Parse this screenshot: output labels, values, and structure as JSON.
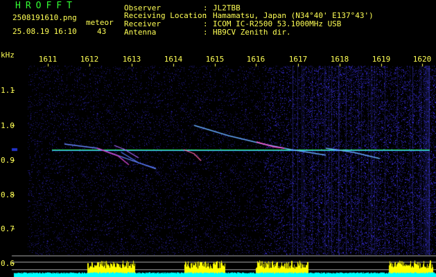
{
  "header": {
    "app_title": "HROFFT",
    "filename": "2508191610.png",
    "datetime": "25.08.19 16:10",
    "meteor_label": "meteor",
    "meteor_count": "43",
    "info_labels": [
      "Observer",
      "Receiving Location",
      "Receiver",
      "Antenna"
    ],
    "info_separator": ":",
    "info_values": [
      "JL2TBB",
      "Hamamatsu, Japan (N34°40' E137°43')",
      "ICOM IC-R2500 53.1000MHz USB",
      "HB9CV Zenith dir."
    ]
  },
  "axes": {
    "y_unit": "kHz",
    "x_ticks": [
      "1611",
      "1612",
      "1613",
      "1614",
      "1615",
      "1616",
      "1617",
      "1618",
      "1619",
      "1620"
    ],
    "y_ticks": [
      "1.1",
      "1.0",
      "0.9",
      "0.8",
      "0.7",
      "0.6"
    ]
  },
  "colors": {
    "background": "#000000",
    "header_text": "#ffff55",
    "app_title": "#33ff33",
    "carrier_line": "#33ff66",
    "level_yellow": "#ffff00",
    "level_cyan": "#00ffff",
    "noise": "#2a2ad6"
  }
}
